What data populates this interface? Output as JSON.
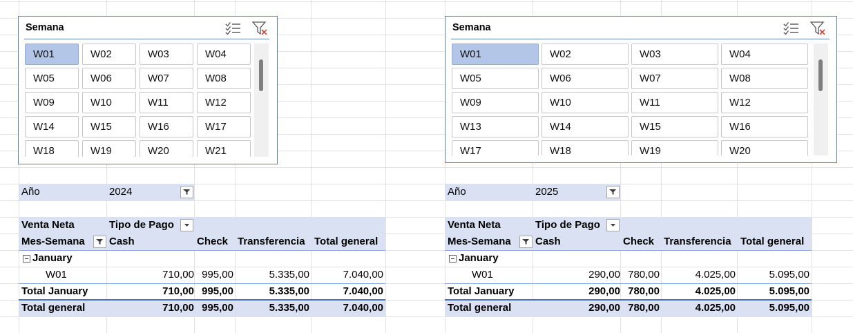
{
  "left": {
    "slicer": {
      "title": "Semana",
      "items": [
        "W01",
        "W02",
        "W03",
        "W04",
        "W05",
        "W06",
        "W07",
        "W08",
        "W09",
        "W10",
        "W11",
        "W12",
        "W14",
        "W15",
        "W16",
        "W17",
        "W18",
        "W19",
        "W20",
        "W21"
      ],
      "selected": "W01"
    },
    "filter": {
      "label": "Año",
      "value": "2024"
    },
    "pivot": {
      "data_field": "Venta Neta",
      "col_field": "Tipo de Pago",
      "row_field": "Mes-Semana",
      "columns": [
        "Cash",
        "Check",
        "Transferencia",
        "Total general"
      ],
      "group": "January",
      "row": {
        "label": "W01",
        "values": [
          "710,00",
          "995,00",
          "5.335,00",
          "7.040,00"
        ]
      },
      "subtotal": {
        "label": "Total January",
        "values": [
          "710,00",
          "995,00",
          "5.335,00",
          "7.040,00"
        ]
      },
      "grandtotal": {
        "label": "Total general",
        "values": [
          "710,00",
          "995,00",
          "5.335,00",
          "7.040,00"
        ]
      }
    }
  },
  "right": {
    "slicer": {
      "title": "Semana",
      "items": [
        "W01",
        "W02",
        "W03",
        "W04",
        "W05",
        "W06",
        "W07",
        "W08",
        "W09",
        "W10",
        "W11",
        "W12",
        "W13",
        "W14",
        "W15",
        "W16",
        "W17",
        "W18",
        "W19",
        "W20"
      ],
      "selected": "W01"
    },
    "filter": {
      "label": "Año",
      "value": "2025"
    },
    "pivot": {
      "data_field": "Venta Neta",
      "col_field": "Tipo de Pago",
      "row_field": "Mes-Semana",
      "columns": [
        "Cash",
        "Check",
        "Transferencia",
        "Total general"
      ],
      "group": "January",
      "row": {
        "label": "W01",
        "values": [
          "290,00",
          "780,00",
          "4.025,00",
          "5.095,00"
        ]
      },
      "subtotal": {
        "label": "Total January",
        "values": [
          "290,00",
          "780,00",
          "4.025,00",
          "5.095,00"
        ]
      },
      "grandtotal": {
        "label": "Total general",
        "values": [
          "290,00",
          "780,00",
          "4.025,00",
          "5.095,00"
        ]
      }
    }
  },
  "icons": {
    "multiselect": "multi-select-icon",
    "clear_filter": "clear-filter-icon",
    "filter_dropdown": "filter-dropdown-icon"
  },
  "colors": {
    "header_band": "#d9e1f2",
    "selected_item": "#b4c6e7",
    "slicer_border": "#5b7fa6",
    "clear_filter_x": "#e03c31"
  }
}
